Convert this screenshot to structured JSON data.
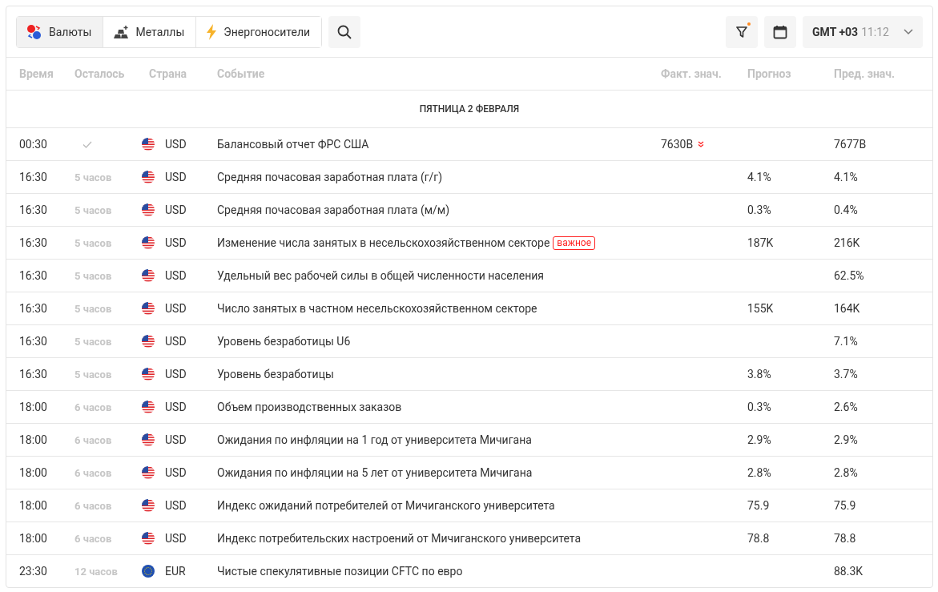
{
  "toolbar": {
    "tabs": [
      {
        "label": "Валюты",
        "kind": "currency",
        "selected": true
      },
      {
        "label": "Металлы",
        "kind": "metals",
        "selected": false
      },
      {
        "label": "Энергоносители",
        "kind": "energy",
        "selected": false
      }
    ],
    "filter_active": true,
    "timezone": {
      "zone": "GMT +03",
      "time": "11:12"
    }
  },
  "table": {
    "columns": [
      "Время",
      "Осталось",
      "Страна",
      "Событие",
      "Факт. знач.",
      "Прогноз",
      "Пред. знач."
    ],
    "date_header": "ПЯТНИЦА 2 ФЕВРАЛЯ",
    "rows": [
      {
        "time": "00:30",
        "done": true,
        "kind": "us",
        "currency": "USD",
        "event": "Балансовый отчет ФРС США",
        "actual": "7630B",
        "falling": true,
        "previous": "7677B"
      },
      {
        "time": "16:30",
        "remaining": "5 часов",
        "kind": "us",
        "currency": "USD",
        "event": "Средняя почасовая заработная плата (г/г)",
        "forecast": "4.1%",
        "previous": "4.1%"
      },
      {
        "time": "16:30",
        "remaining": "5 часов",
        "kind": "us",
        "currency": "USD",
        "event": "Средняя почасовая заработная плата (м/м)",
        "forecast": "0.3%",
        "previous": "0.4%"
      },
      {
        "time": "16:30",
        "remaining": "5 часов",
        "kind": "us",
        "currency": "USD",
        "event": "Изменение числа занятых в несельскохозяйственном секторе",
        "badge": "важное",
        "forecast": "187K",
        "previous": "216K"
      },
      {
        "time": "16:30",
        "remaining": "5 часов",
        "kind": "us",
        "currency": "USD",
        "event": "Удельный вес рабочей силы в общей численности населения",
        "previous": "62.5%"
      },
      {
        "time": "16:30",
        "remaining": "5 часов",
        "kind": "us",
        "currency": "USD",
        "event": "Число занятых в частном несельскохозяйственном секторе",
        "forecast": "155K",
        "previous": "164K"
      },
      {
        "time": "16:30",
        "remaining": "5 часов",
        "kind": "us",
        "currency": "USD",
        "event": "Уровень безработицы U6",
        "previous": "7.1%"
      },
      {
        "time": "16:30",
        "remaining": "5 часов",
        "kind": "us",
        "currency": "USD",
        "event": "Уровень безработицы",
        "forecast": "3.8%",
        "previous": "3.7%"
      },
      {
        "time": "18:00",
        "remaining": "6 часов",
        "kind": "us",
        "currency": "USD",
        "event": "Объем производственных заказов",
        "forecast": "0.3%",
        "previous": "2.6%"
      },
      {
        "time": "18:00",
        "remaining": "6 часов",
        "kind": "us",
        "currency": "USD",
        "event": "Ожидания по инфляции на 1 год от университета Мичигана",
        "forecast": "2.9%",
        "previous": "2.9%"
      },
      {
        "time": "18:00",
        "remaining": "6 часов",
        "kind": "us",
        "currency": "USD",
        "event": "Ожидания по инфляции на 5 лет от университета Мичигана",
        "forecast": "2.8%",
        "previous": "2.8%"
      },
      {
        "time": "18:00",
        "remaining": "6 часов",
        "kind": "us",
        "currency": "USD",
        "event": "Индекс ожиданий потребителей от Мичиганского университета",
        "forecast": "75.9",
        "previous": "75.9"
      },
      {
        "time": "18:00",
        "remaining": "6 часов",
        "kind": "us",
        "currency": "USD",
        "event": "Индекс потребительских настроений от Мичиганского университета",
        "forecast": "78.8",
        "previous": "78.8"
      },
      {
        "time": "23:30",
        "remaining": "12 часов",
        "kind": "eu",
        "currency": "EUR",
        "event": "Чистые спекулятивные позиции CFTC по евро",
        "previous": "88.3K"
      }
    ]
  }
}
